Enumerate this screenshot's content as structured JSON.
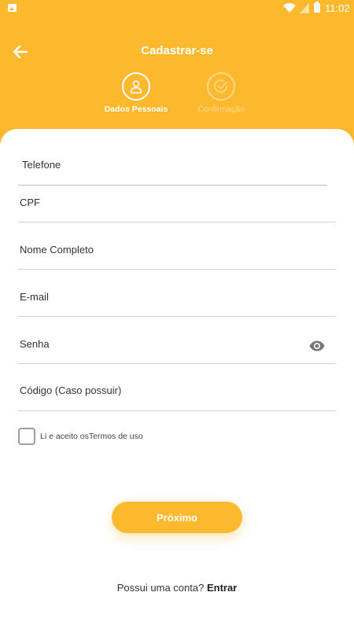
{
  "status_bar": {
    "time": "11:02",
    "icons": [
      "image-icon",
      "wifi-icon",
      "signal-icon",
      "battery-icon"
    ]
  },
  "header": {
    "title": "Cadastrar-se",
    "back_icon": "arrow-left-icon",
    "background": "#FDB92E"
  },
  "stepper": [
    {
      "label": "Dados Pessoais",
      "icon": "user-icon",
      "active": true
    },
    {
      "label": "Confirmação",
      "icon": "check-circle-icon",
      "active": false
    }
  ],
  "form": {
    "telefone_placeholder": "Telefone",
    "cpf_placeholder": "CPF",
    "nome_placeholder": "Nome Completo",
    "email_placeholder": "E-mail",
    "senha_placeholder": "Senha",
    "codigo_placeholder": "Código (Caso possuir)",
    "password_toggle_icon": "eye-icon"
  },
  "terms": {
    "label": "Li e aceito osTermos de uso",
    "checked": false
  },
  "next_button": {
    "label": "Próximo"
  },
  "footer": {
    "question": "Possui uma conta?",
    "link": "Entrar"
  }
}
